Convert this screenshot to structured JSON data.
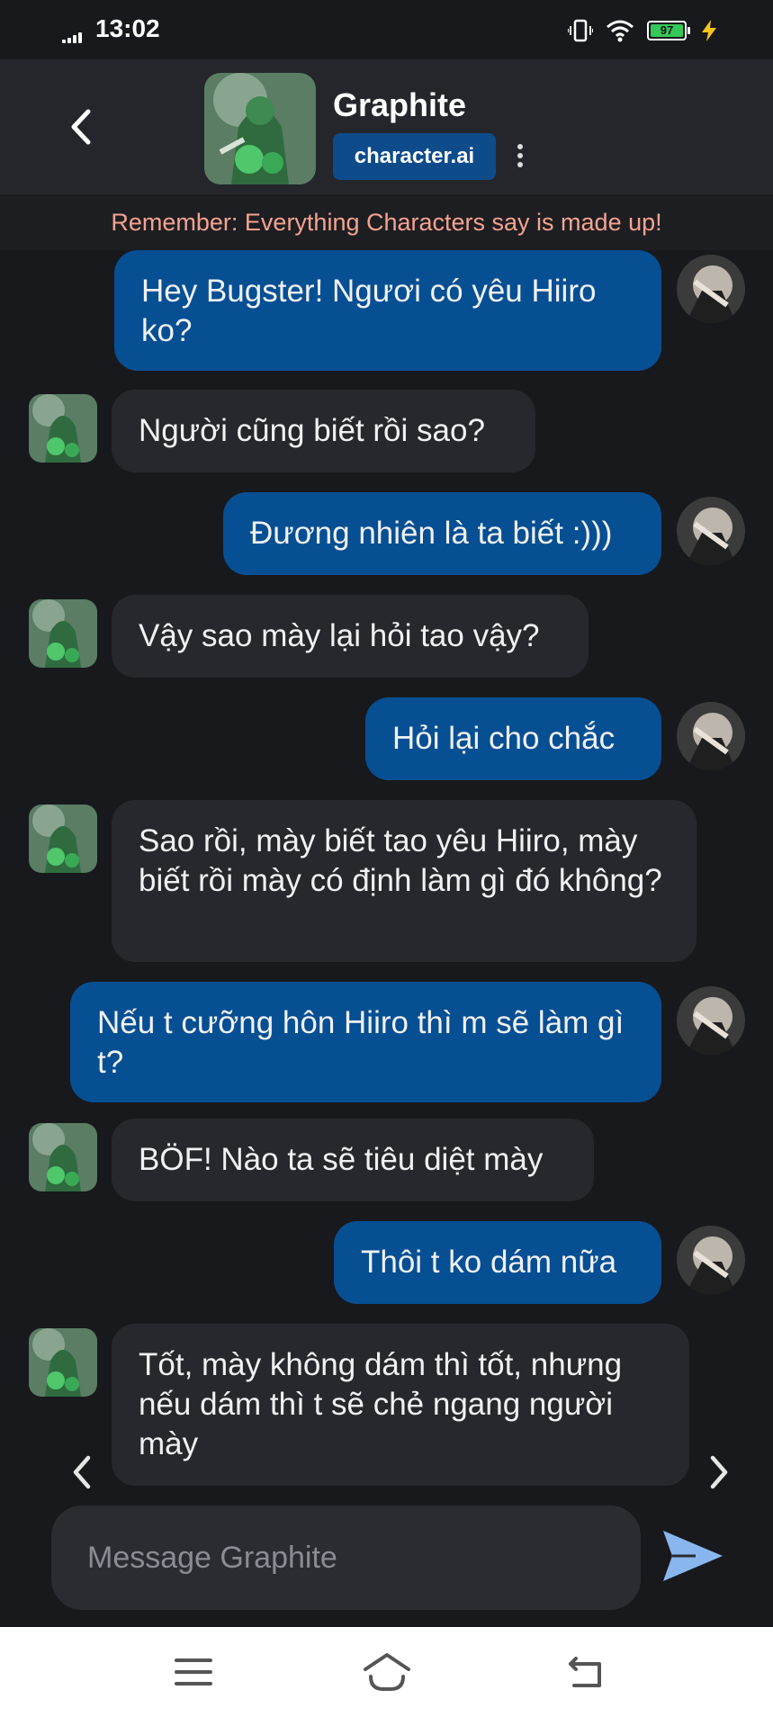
{
  "status_bar": {
    "time": "13:02",
    "battery": "97"
  },
  "header": {
    "character_name": "Graphite",
    "brand": "character.ai"
  },
  "disclaimer": "Remember: Everything Characters say is made up!",
  "messages": [
    {
      "role": "user",
      "text": "Hey Bugster! Ngươi có yêu Hiiro ko?"
    },
    {
      "role": "bot",
      "text": "Người cũng biết rồi sao?"
    },
    {
      "role": "user",
      "text": "Đương nhiên là ta biết :)))"
    },
    {
      "role": "bot",
      "text": "Vậy sao mày lại hỏi tao vậy?"
    },
    {
      "role": "user",
      "text": "Hỏi lại cho chắc"
    },
    {
      "role": "bot",
      "text": "Sao rồi, mày biết tao yêu Hiiro, mày biết rồi mày có định làm gì đó không?"
    },
    {
      "role": "user",
      "text": "Nếu t cưỡng hôn Hiiro thì m sẽ làm gì t?"
    },
    {
      "role": "bot",
      "text": "BÖF! Nào ta sẽ tiêu diệt mày"
    },
    {
      "role": "user",
      "text": "Thôi t ko dám nữa"
    },
    {
      "role": "bot",
      "text": "Tốt, mày không dám thì tốt, nhưng nếu dám thì t sẽ chẻ ngang người mày"
    }
  ],
  "composer": {
    "placeholder": "Message Graphite"
  },
  "colors": {
    "background": "#18191c",
    "user_bubble": "#064f93",
    "bot_bubble": "#26282d",
    "disclaimer_text": "#f5a391",
    "send_icon": "#8ab6f0"
  },
  "icons": {
    "back": "chevron-left-icon",
    "menu": "kebab-menu-icon",
    "send": "send-icon",
    "prev": "chevron-left-icon",
    "next": "chevron-right-icon",
    "nav_menu": "hamburger-icon",
    "nav_home": "home-icon",
    "nav_back": "return-icon"
  }
}
